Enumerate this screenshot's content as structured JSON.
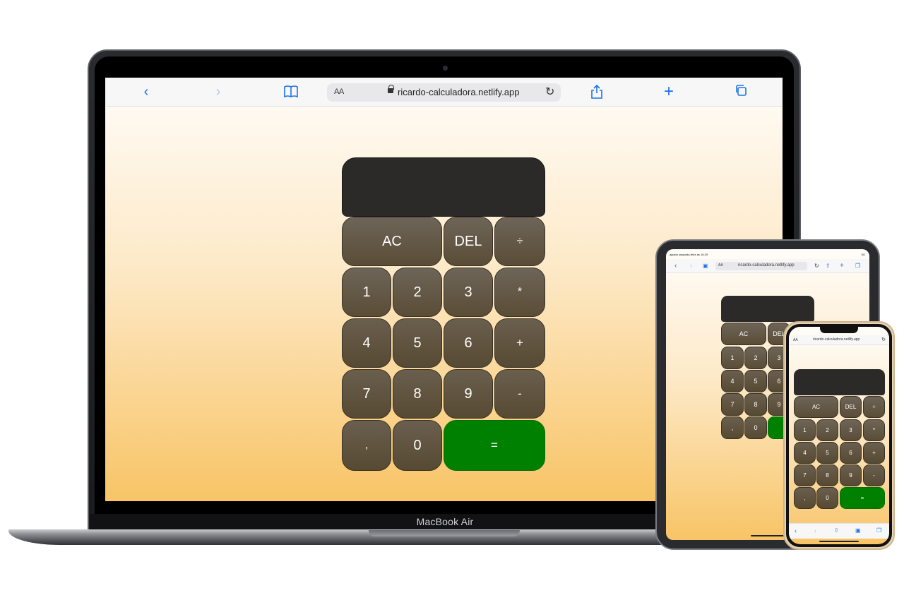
{
  "device_label": "MacBook Air",
  "browser": {
    "url": "ricardo-calculadora.netlify.app",
    "text_size_label": "AA",
    "icons": {
      "back": "chevron-left-icon",
      "forward": "chevron-right-icon",
      "bookmarks": "book-icon",
      "lock": "lock-icon",
      "reload": "reload-icon",
      "share": "share-icon",
      "new_tab": "plus-icon",
      "tabs": "tabs-icon"
    }
  },
  "ipad": {
    "status_time": "agosto segunda-feira às 18:29",
    "status_right": "5G"
  },
  "calculator": {
    "display_value": "",
    "keys": {
      "ac": "AC",
      "del": "DEL",
      "divide": "÷",
      "multiply": "*",
      "plus": "+",
      "minus": "-",
      "comma": ",",
      "equals": "=",
      "d0": "0",
      "d1": "1",
      "d2": "2",
      "d3": "3",
      "d4": "4",
      "d5": "5",
      "d6": "6",
      "d7": "7",
      "d8": "8",
      "d9": "9"
    },
    "colors": {
      "display": "#2c2a28",
      "key": "#5f5343",
      "equals": "#008000",
      "background_top": "#fffdf9",
      "background_bottom": "#f8c466"
    }
  }
}
